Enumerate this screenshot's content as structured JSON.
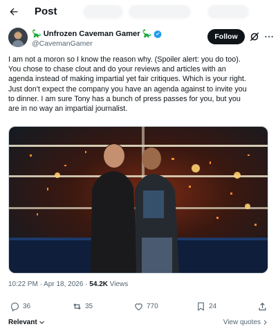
{
  "header": {
    "title": "Post",
    "back_icon": "arrow-left-icon"
  },
  "author": {
    "name": "Unfrozen Caveman Gamer",
    "emoji_left": "🦕",
    "emoji_right": "🦕",
    "handle": "@CavemanGamer",
    "verified": true,
    "verified_color": "#1d9bf0"
  },
  "follow_label": "Follow",
  "tweet_text": "I am not a moron so I know the reason why. (Spoiler alert: you do too).\nYou chose to chase clout and do your reviews and articles with an\nagenda instead of making impartial yet fair critiques. Which is your right.\nJust don't expect the company you have an agenda against to invite you\nto dinner.  I am sure Tony has a bunch of press passes for you, but you\nare in no way an impartial journalist.",
  "meta": {
    "time": "10:22 PM · Apr 18, 2026 · ",
    "views_count": "54.2K",
    "views_label": " Views"
  },
  "actions": {
    "replies": "36",
    "reposts": "35",
    "likes": "770",
    "bookmarks": "24"
  },
  "footer": {
    "sort_label": "Relevant",
    "view_quotes": "View quotes"
  },
  "colors": {
    "text": "#0f1419",
    "secondary": "#536471",
    "accent": "#1d9bf0"
  }
}
